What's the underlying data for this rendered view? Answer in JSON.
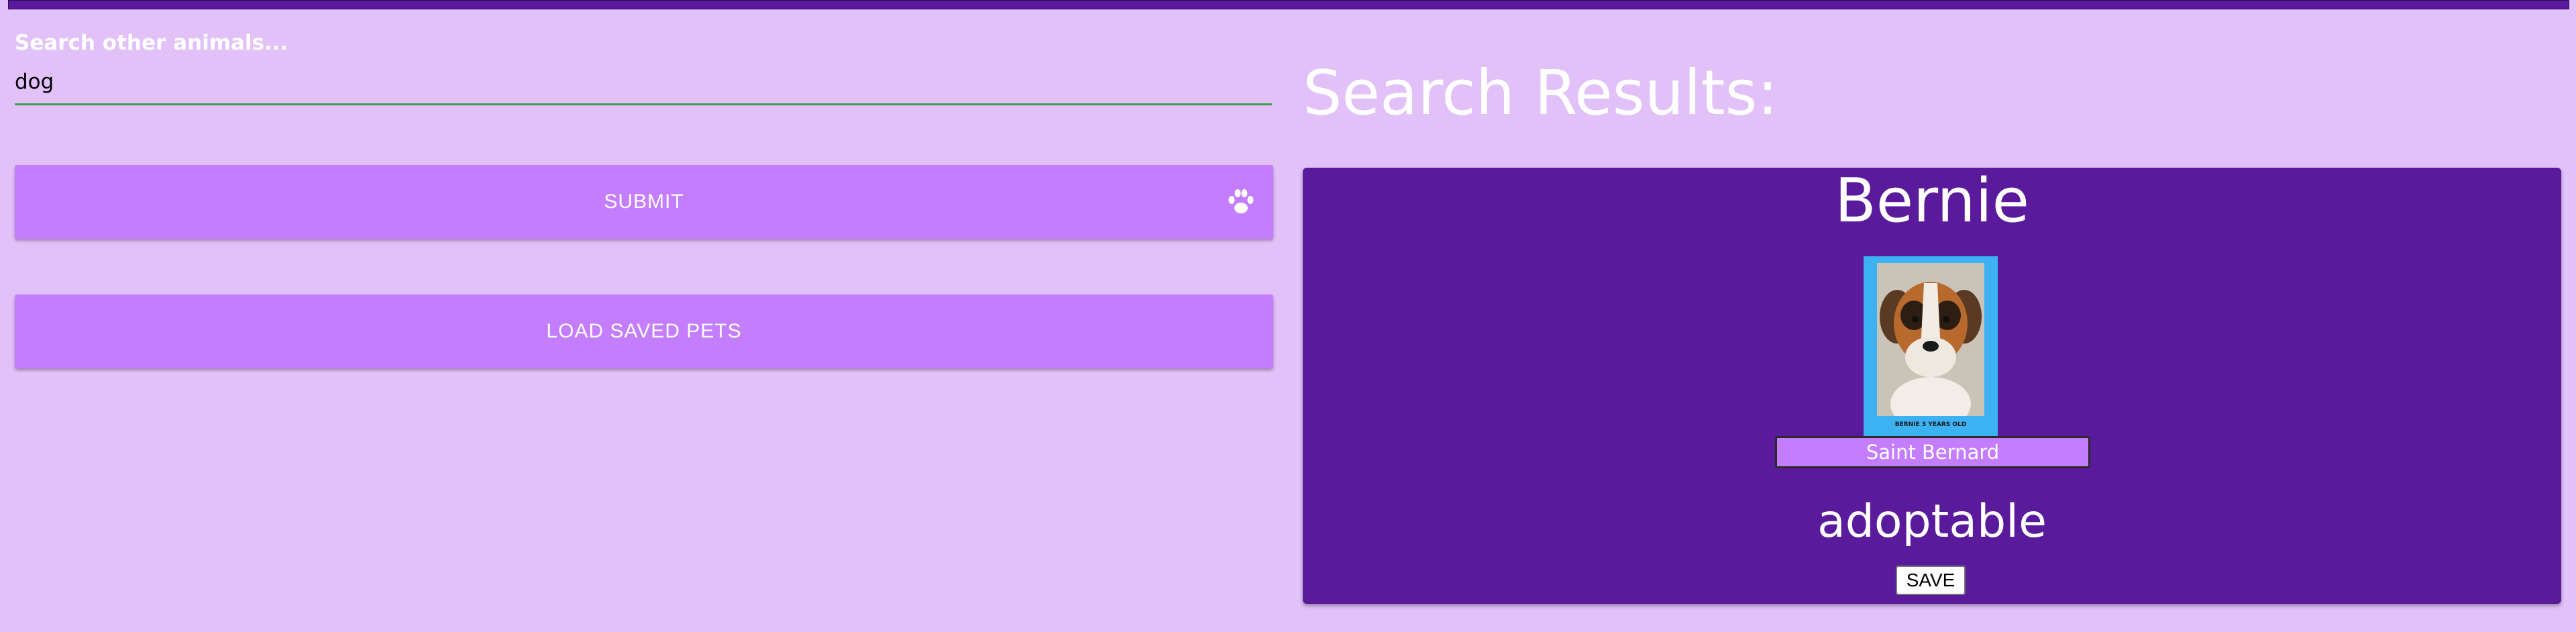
{
  "search": {
    "label": "Search other animals...",
    "value": "dog"
  },
  "buttons": {
    "submit_label": "SUBMIT",
    "load_saved_label": "LOAD SAVED PETS"
  },
  "results": {
    "title": "Search Results:",
    "items": [
      {
        "name": "Bernie",
        "photo_caption": "BERNIE 3 YEARS OLD",
        "breed": "Saint Bernard",
        "status": "adoptable",
        "save_label": "SAVE"
      }
    ]
  },
  "icons": {
    "submit_icon": "paw-icon"
  },
  "colors": {
    "background": "#e2c1f9",
    "accent_purple": "#c47dfc",
    "dark_purple": "#5a1a9c",
    "input_underline": "#3aa34a",
    "photo_frame": "#3cb2f2"
  }
}
